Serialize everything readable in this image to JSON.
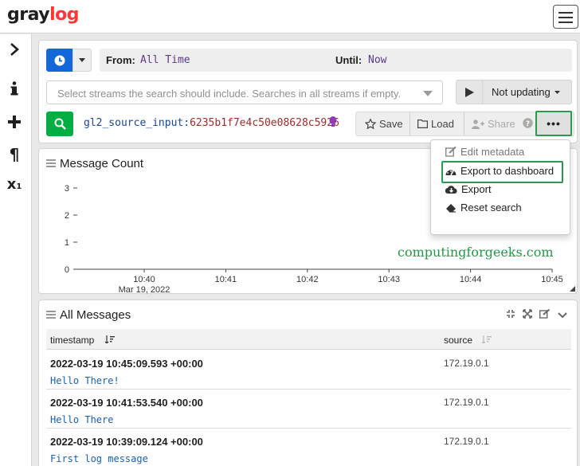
{
  "app": {
    "logo_left": "gray",
    "logo_accent": "log",
    "brand_color": "#ff3633"
  },
  "sidebar": {
    "items": [
      {
        "icon": "chevron-right-icon",
        "glyph": "›"
      },
      {
        "icon": "info-icon",
        "glyph": "i"
      },
      {
        "icon": "plus-icon",
        "glyph": "+"
      },
      {
        "icon": "paragraph-icon",
        "glyph": "¶"
      },
      {
        "icon": "variable-icon",
        "glyph": "x₁"
      }
    ]
  },
  "search": {
    "from_label": "From:",
    "from_value": "All Time",
    "until_label": "Until:",
    "until_value": "Now",
    "streams_placeholder": "Select streams the search should include. Searches in all streams if empty.",
    "refresh_label": "Not updating",
    "query_key": "gl2_source_input:",
    "query_value": "6235b1f7e4c50e08628c5926",
    "save_label": "Save",
    "load_label": "Load",
    "share_label": "Share",
    "more_label": "•••"
  },
  "menu": {
    "items": [
      {
        "label": "Edit metadata",
        "icon": "edit-icon",
        "disabled": true
      },
      {
        "label": "Export to dashboard",
        "icon": "dashboard-icon",
        "disabled": false
      },
      {
        "label": "Export",
        "icon": "cloud-download-icon",
        "disabled": false
      },
      {
        "label": "Reset search",
        "icon": "eraser-icon",
        "disabled": false
      }
    ]
  },
  "message_count": {
    "title": "Message Count",
    "watermark": "computingforgeeks.com"
  },
  "chart_data": {
    "type": "line",
    "title": "Message Count",
    "x": [
      "10:40",
      "10:41",
      "10:42",
      "10:43",
      "10:44",
      "10:45"
    ],
    "date_label": "Mar 19, 2022",
    "y_ticks": [
      0,
      1,
      2,
      3
    ],
    "ylim": [
      0,
      3
    ],
    "series": [
      {
        "values": [
          0,
          0,
          0,
          0,
          0,
          0
        ]
      }
    ]
  },
  "messages": {
    "title": "All Messages",
    "columns": [
      "timestamp",
      "source"
    ],
    "rows": [
      {
        "timestamp": "2022-03-19 10:45:09.593 +00:00",
        "message": "Hello There!",
        "source": "172.19.0.1"
      },
      {
        "timestamp": "2022-03-19 10:41:53.540 +00:00",
        "message": "Hello There",
        "source": "172.19.0.1"
      },
      {
        "timestamp": "2022-03-19 10:39:09.124 +00:00",
        "message": "First log message",
        "source": "172.19.0.1"
      }
    ]
  }
}
